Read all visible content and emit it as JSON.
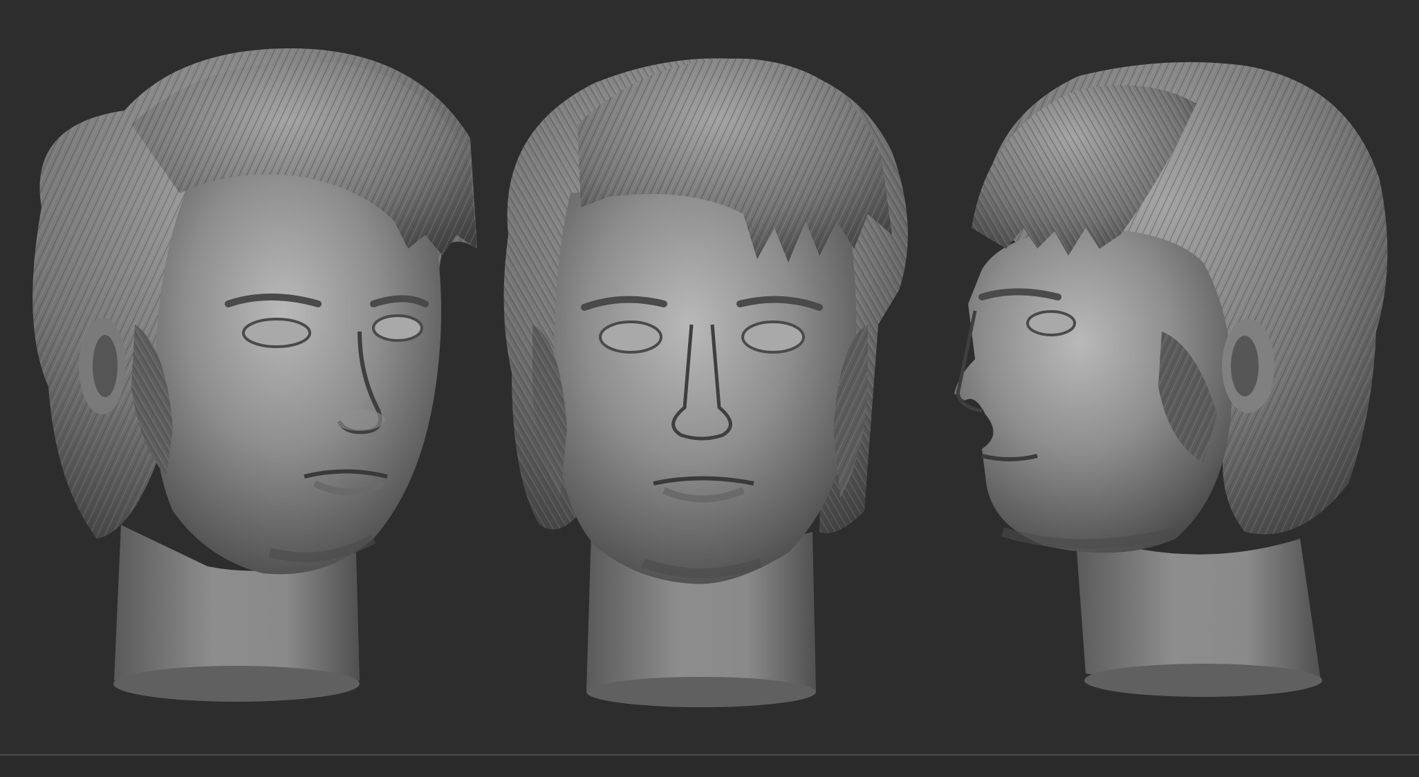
{
  "viewport": {
    "background_color": "#2d2d2d",
    "material_color": "#8a8a8a"
  },
  "models": [
    {
      "id": "head-three-quarter-left",
      "view": "three-quarter"
    },
    {
      "id": "head-front",
      "view": "front"
    },
    {
      "id": "head-profile-left",
      "view": "profile"
    }
  ],
  "bottom_bar": {
    "divider_color": "#4d4d4d"
  }
}
